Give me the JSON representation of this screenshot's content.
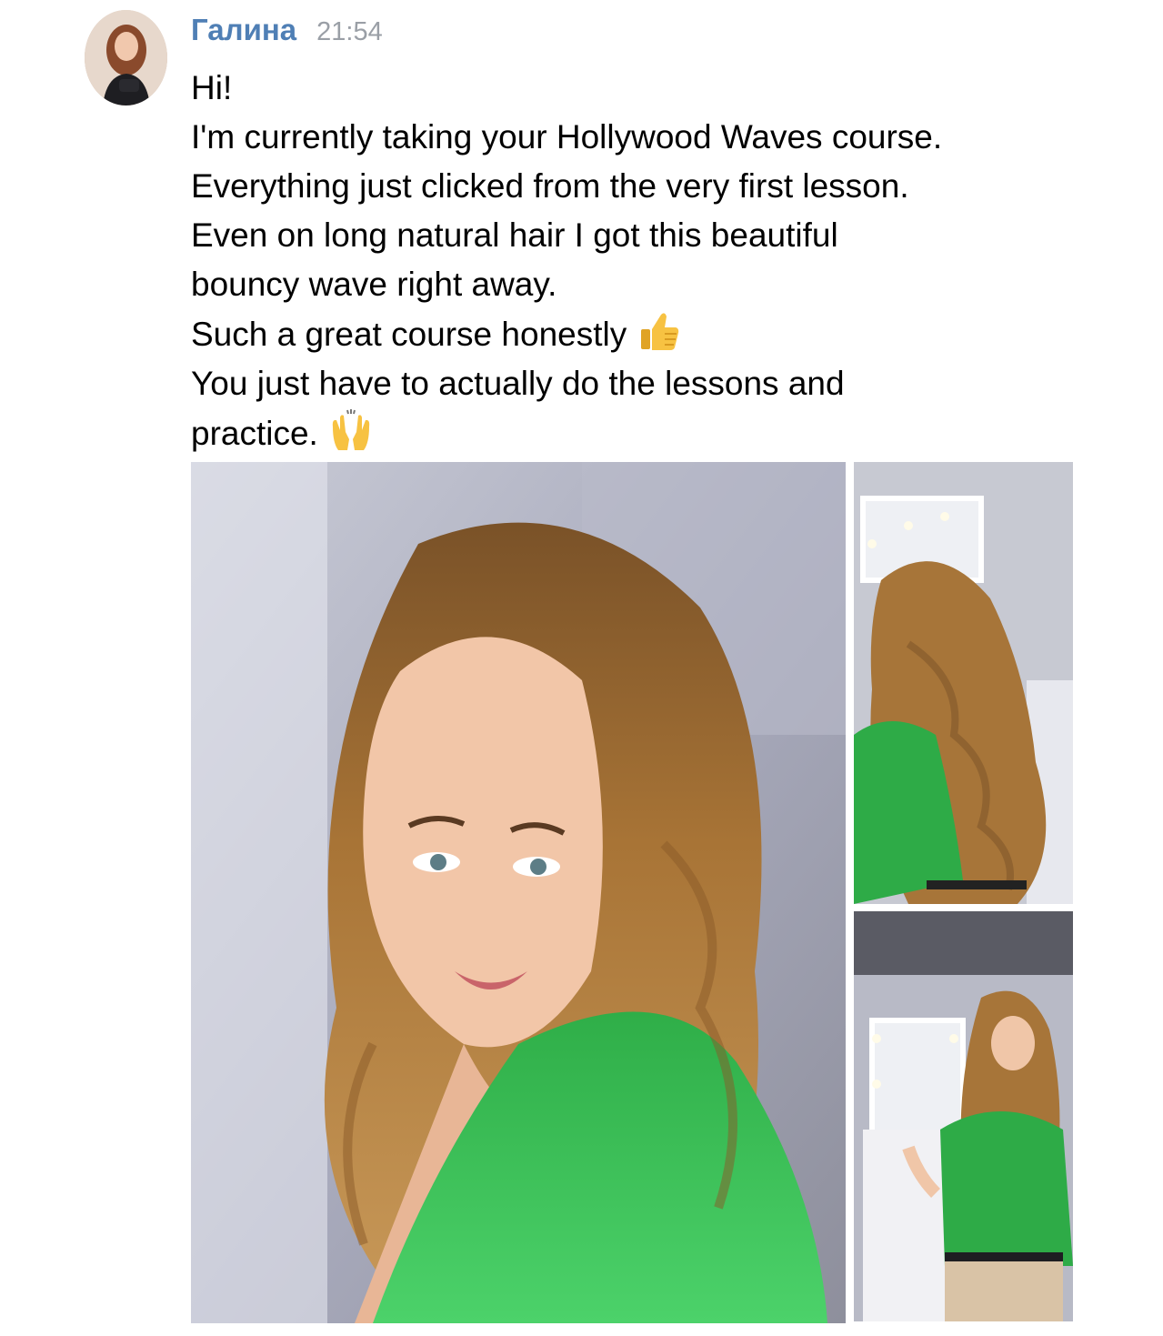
{
  "message": {
    "author": "Галина",
    "time": "21:54",
    "lines": [
      "Hi!",
      "I'm currently taking your Hollywood Waves course.",
      "Everything just clicked from the very first lesson.",
      "Even on long natural hair I got this beautiful",
      "bouncy wave right away.",
      "Such a great course honestly",
      "You just have to actually do the lessons and",
      "practice."
    ],
    "emojis": [
      "thumbs-up-icon",
      "raised-hands-icon"
    ]
  },
  "colors": {
    "author": "#4f7fb5",
    "time": "#9a9fa6",
    "text": "#000000",
    "background": "#ffffff",
    "shirt": "#3bb54a",
    "hair": "#b07a3d"
  },
  "attachments": [
    {
      "kind": "photo",
      "subject": "portrait with hollywood waves"
    },
    {
      "kind": "photo",
      "subject": "back view of waves"
    },
    {
      "kind": "photo",
      "subject": "full view at mirror"
    }
  ]
}
